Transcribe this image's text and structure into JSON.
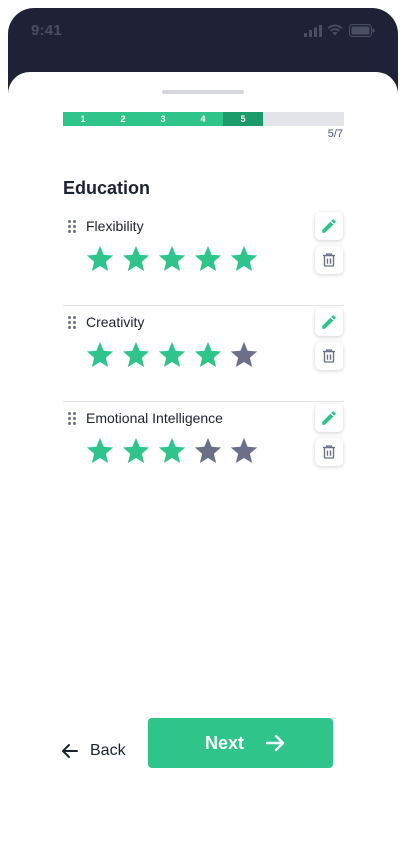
{
  "status_bar": {
    "time": "9:41"
  },
  "progress": {
    "steps": [
      "1",
      "2",
      "3",
      "4",
      "5"
    ],
    "completed": 4,
    "current": 5,
    "total": 7,
    "counter": "5/7"
  },
  "section_title": "Education",
  "skills": [
    {
      "name": "Flexibility",
      "rating": 5,
      "max_rating": 5
    },
    {
      "name": "Creativity",
      "rating": 4,
      "max_rating": 5
    },
    {
      "name": "Emotional Intelligence",
      "rating": 3,
      "max_rating": 5
    }
  ],
  "icons": {
    "edit": "pencil-icon",
    "delete": "trash-icon",
    "drag": "drag-handle-icon",
    "back": "arrow-left-icon",
    "next": "arrow-right-icon"
  },
  "colors": {
    "accent": "#2ec48a",
    "accent_dark": "#1c9b6a",
    "star_filled": "#2ec48a",
    "star_empty": "#6b7088",
    "header_bg": "#1f2236"
  },
  "footer": {
    "back_label": "Back",
    "next_label": "Next"
  }
}
